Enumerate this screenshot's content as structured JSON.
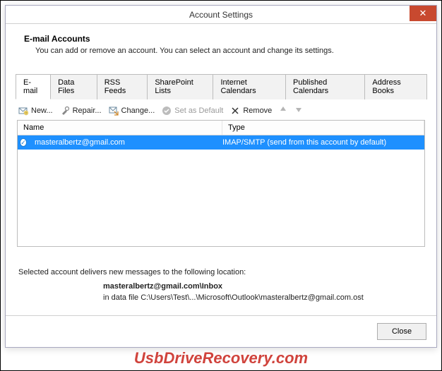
{
  "dialog": {
    "title": "Account Settings",
    "close_x": "✕"
  },
  "header": {
    "title": "E-mail Accounts",
    "desc": "You can add or remove an account. You can select an account and change its settings."
  },
  "tabs": [
    {
      "label": "E-mail",
      "active": true
    },
    {
      "label": "Data Files"
    },
    {
      "label": "RSS Feeds"
    },
    {
      "label": "SharePoint Lists"
    },
    {
      "label": "Internet Calendars"
    },
    {
      "label": "Published Calendars"
    },
    {
      "label": "Address Books"
    }
  ],
  "toolbar": {
    "new_label": "New...",
    "repair_label": "Repair...",
    "change_label": "Change...",
    "default_label": "Set as Default",
    "remove_label": "Remove"
  },
  "columns": {
    "name": "Name",
    "type": "Type"
  },
  "rows": [
    {
      "name": "masteralbertz@gmail.com",
      "type": "IMAP/SMTP (send from this account by default)"
    }
  ],
  "info": {
    "line1": "Selected account delivers new messages to the following location:",
    "target": "masteralbertz@gmail.com\\Inbox",
    "path": "in data file C:\\Users\\Test\\...\\Microsoft\\Outlook\\masteralbertz@gmail.com.ost"
  },
  "footer": {
    "close_label": "Close"
  },
  "watermark": "UsbDriveRecovery.com"
}
